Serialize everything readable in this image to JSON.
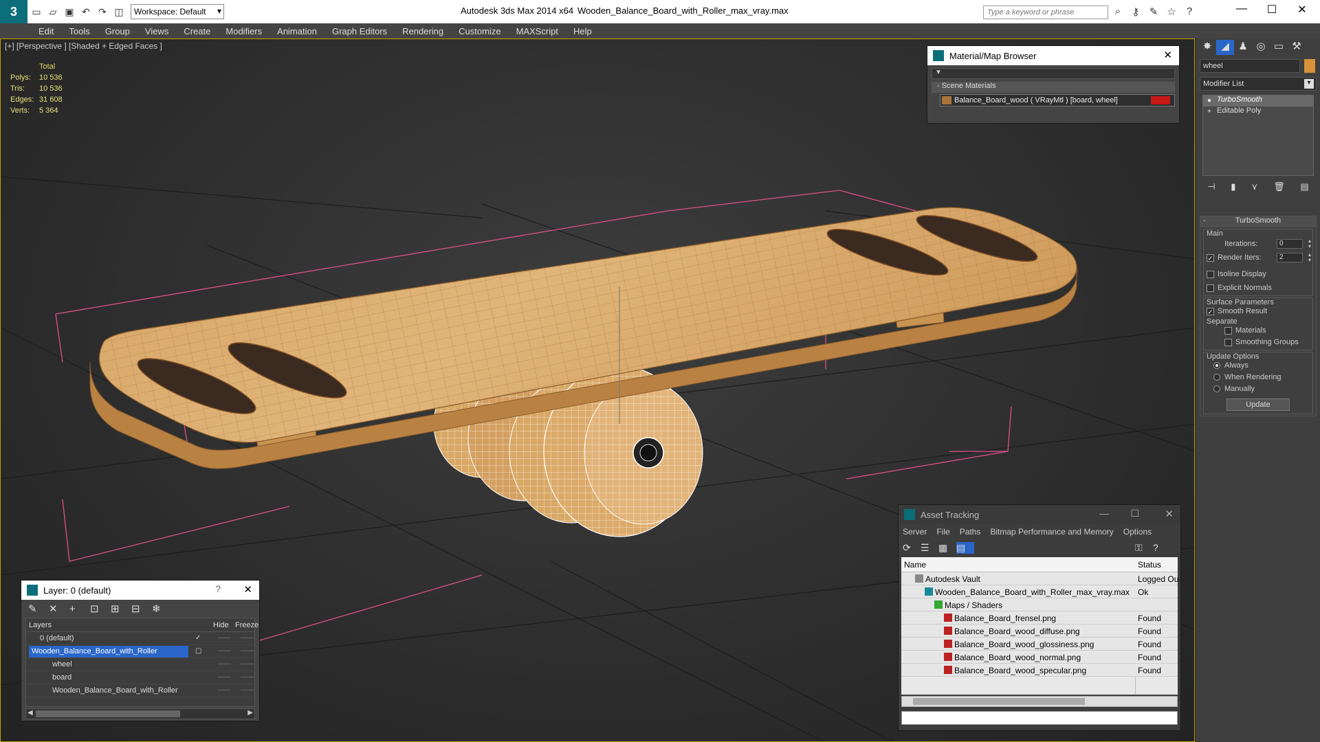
{
  "window": {
    "app_title": "Autodesk 3ds Max  2014 x64",
    "file_name": "Wooden_Balance_Board_with_Roller_max_vray.max",
    "workspace": "Workspace: Default",
    "search_placeholder": "Type a keyword or phrase"
  },
  "menu": [
    "Edit",
    "Tools",
    "Group",
    "Views",
    "Create",
    "Modifiers",
    "Animation",
    "Graph Editors",
    "Rendering",
    "Customize",
    "MAXScript",
    "Help"
  ],
  "viewport": {
    "label": "[+] [Perspective ] [Shaded + Edged Faces ]",
    "stats": {
      "header": "Total",
      "rows": [
        {
          "k": "Polys:",
          "v": "10 536"
        },
        {
          "k": "Tris:",
          "v": "10 536"
        },
        {
          "k": "Edges:",
          "v": "31 608"
        },
        {
          "k": "Verts:",
          "v": "5 364"
        }
      ]
    },
    "wood_color": "#d9a866",
    "bbox_color": "#e0508a"
  },
  "command_panel": {
    "object_name": "wheel",
    "object_color": "#d8923a",
    "modifier_list": "Modifier List",
    "stack": [
      "TurboSmooth",
      "Editable Poly"
    ],
    "turbosmooth": {
      "title": "TurboSmooth",
      "main": "Main",
      "iterations_label": "Iterations:",
      "iterations": "0",
      "render_iters_label": "Render Iters:",
      "render_iters": "2",
      "isoline": "Isoline Display",
      "explicit": "Explicit Normals",
      "surface": "Surface Parameters",
      "smooth_result": "Smooth Result",
      "separate": "Separate",
      "materials": "Materials",
      "smoothing_groups": "Smoothing Groups",
      "update_options": "Update Options",
      "always": "Always",
      "when_rendering": "When Rendering",
      "manually": "Manually",
      "update": "Update"
    }
  },
  "material_browser": {
    "title": "Material/Map Browser",
    "group": "- Scene Materials",
    "item": "Balance_Board_wood  ( VRayMtl ) [board, wheel]"
  },
  "layer_window": {
    "title": "Layer: 0 (default)",
    "help": "?",
    "col_layers": "Layers",
    "col_hide": "Hide",
    "col_freeze": "Freeze",
    "rows": [
      "0 (default)",
      "Wooden_Balance_Board_with_Roller",
      "wheel",
      "board",
      "Wooden_Balance_Board_with_Roller"
    ]
  },
  "asset_tracking": {
    "title": "Asset Tracking",
    "menu": [
      "Server",
      "File",
      "Paths",
      "Bitmap Performance and Memory",
      "Options"
    ],
    "col_name": "Name",
    "col_status": "Status",
    "rows": [
      {
        "name": "Autodesk Vault",
        "status": "Logged Ou",
        "indent": 20,
        "icon": "vault"
      },
      {
        "name": "Wooden_Balance_Board_with_Roller_max_vray.max",
        "status": "Ok",
        "indent": 34,
        "icon": "max"
      },
      {
        "name": "Maps / Shaders",
        "status": "",
        "indent": 48,
        "icon": "fold"
      },
      {
        "name": "Balance_Board_frensel.png",
        "status": "Found",
        "indent": 62,
        "icon": "png"
      },
      {
        "name": "Balance_Board_wood_diffuse.png",
        "status": "Found",
        "indent": 62,
        "icon": "png"
      },
      {
        "name": "Balance_Board_wood_glossiness.png",
        "status": "Found",
        "indent": 62,
        "icon": "png"
      },
      {
        "name": "Balance_Board_wood_normal.png",
        "status": "Found",
        "indent": 62,
        "icon": "png"
      },
      {
        "name": "Balance_Board_wood_specular.png",
        "status": "Found",
        "indent": 62,
        "icon": "png"
      }
    ]
  }
}
